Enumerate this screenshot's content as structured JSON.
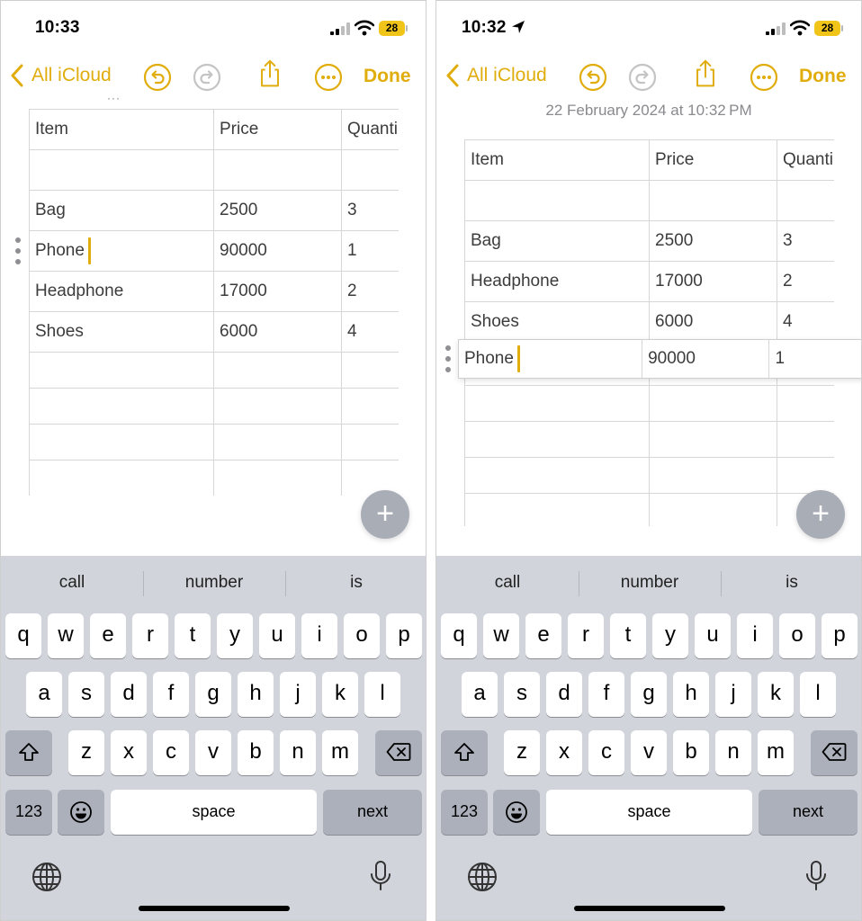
{
  "left": {
    "status": {
      "time": "10:33",
      "battery": "28"
    },
    "toolbar": {
      "back_label": "All iCloud",
      "done_label": "Done"
    },
    "table": {
      "headers": [
        "Item",
        "Price",
        "Quanti"
      ],
      "rows": [
        [
          "",
          "",
          ""
        ],
        [
          "Bag",
          "2500",
          "3"
        ],
        [
          "Phone",
          "90000",
          "1"
        ],
        [
          "Headphone",
          "17000",
          "2"
        ],
        [
          "Shoes",
          "6000",
          "4"
        ]
      ]
    }
  },
  "right": {
    "status": {
      "time": "10:32",
      "battery": "28"
    },
    "toolbar": {
      "back_label": "All iCloud",
      "done_label": "Done"
    },
    "note_date": "22 February 2024 at 10:32 PM",
    "table": {
      "headers": [
        "Item",
        "Price",
        "Quanti"
      ],
      "rows": [
        [
          "",
          "",
          ""
        ],
        [
          "Bag",
          "2500",
          "3"
        ],
        [
          "Headphone",
          "17000",
          "2"
        ],
        [
          "Shoes",
          "6000",
          "4"
        ]
      ],
      "moving_row": [
        "Phone",
        "90000",
        "1"
      ]
    }
  },
  "keyboard": {
    "predictions": [
      "call",
      "number",
      "is"
    ],
    "row1": [
      "q",
      "w",
      "e",
      "r",
      "t",
      "y",
      "u",
      "i",
      "o",
      "p"
    ],
    "row2": [
      "a",
      "s",
      "d",
      "f",
      "g",
      "h",
      "j",
      "k",
      "l"
    ],
    "row3": [
      "z",
      "x",
      "c",
      "v",
      "b",
      "n",
      "m"
    ],
    "numbers_label": "123",
    "space_label": "space",
    "next_label": "next"
  },
  "fab_label": "+",
  "colors": {
    "accent": "#e0ad0d",
    "keyboard_bg": "#d1d4db",
    "dark_key": "#abb0bb",
    "fab": "#a9aeb6",
    "battery": "#f0c419"
  },
  "icons": [
    "chevron-left-icon",
    "undo-icon",
    "redo-icon",
    "share-icon",
    "more-icon",
    "location-arrow-icon",
    "signal-icon",
    "wifi-icon",
    "shift-icon",
    "backspace-icon",
    "emoji-icon",
    "globe-icon",
    "microphone-icon",
    "plus-icon"
  ]
}
